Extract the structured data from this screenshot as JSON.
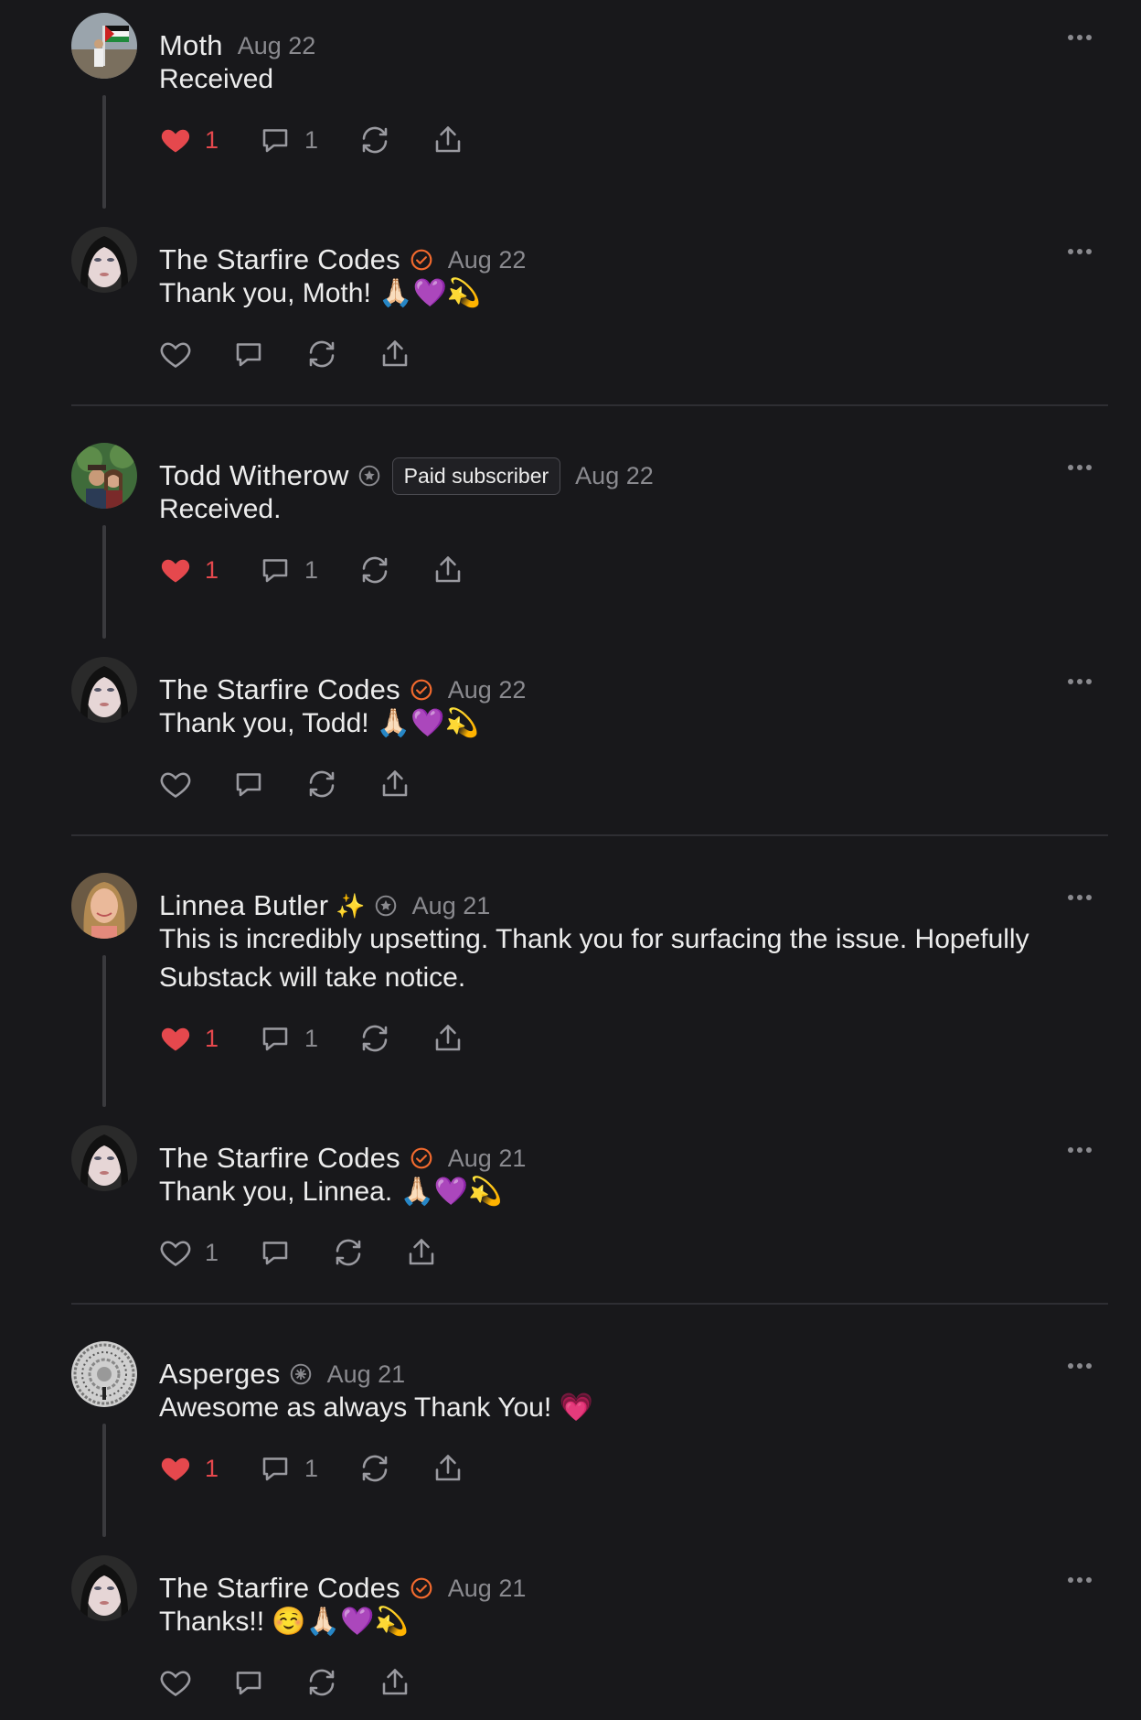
{
  "comments": [
    {
      "author": "Moth",
      "date": "Aug 22",
      "text": "Received",
      "liked": true,
      "likes": "1",
      "replies": "1"
    },
    {
      "author": "The Starfire Codes",
      "date": "Aug 22",
      "text": "Thank you, Moth! 🙏🏻💜💫",
      "liked": false,
      "likes": "",
      "replies": ""
    },
    {
      "author": "Todd Witherow",
      "date": "Aug 22",
      "badge": "Paid subscriber",
      "text": "Received.",
      "liked": true,
      "likes": "1",
      "replies": "1"
    },
    {
      "author": "The Starfire Codes",
      "date": "Aug 22",
      "text": "Thank you, Todd! 🙏🏻💜💫",
      "liked": false,
      "likes": "",
      "replies": ""
    },
    {
      "author": "Linnea Butler",
      "sparkle": "✨",
      "date": "Aug 21",
      "text": "This is incredibly upsetting. Thank you for surfacing the issue. Hopefully Substack will take notice.",
      "liked": true,
      "likes": "1",
      "replies": "1"
    },
    {
      "author": "The Starfire Codes",
      "date": "Aug 21",
      "text": "Thank you, Linnea. 🙏🏻💜💫",
      "liked": false,
      "likes": "1",
      "replies": ""
    },
    {
      "author": "Asperges",
      "date": "Aug 21",
      "text": "Awesome as always Thank You! 💗",
      "liked": true,
      "likes": "1",
      "replies": "1"
    },
    {
      "author": "The Starfire Codes",
      "date": "Aug 21",
      "text": "Thanks!! ☺️🙏🏻💜💫",
      "liked": false,
      "likes": "",
      "replies": ""
    }
  ],
  "colors": {
    "background": "#18181b",
    "liked": "#e5484d",
    "verified": "#f26a2e",
    "muted": "#8a8a8f"
  }
}
